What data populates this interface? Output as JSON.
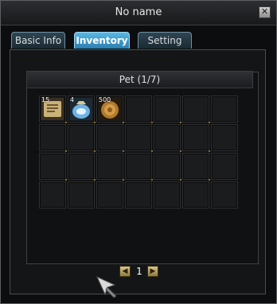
{
  "window": {
    "title": "No name",
    "close_label": "✕"
  },
  "tabs": [
    {
      "label": "Basic Info",
      "active": false
    },
    {
      "label": "Inventory",
      "active": true
    },
    {
      "label": "Setting",
      "active": false
    }
  ],
  "inventory": {
    "header": "Pet (1/7)",
    "columns": 7,
    "rows": 4,
    "items": [
      {
        "slot": 0,
        "count": "15",
        "icon": "scroll-icon",
        "color": "#c9b27a"
      },
      {
        "slot": 1,
        "count": "4",
        "icon": "blue-bag-icon",
        "color": "#6fb3e6"
      },
      {
        "slot": 2,
        "count": "500",
        "icon": "bronze-coin-icon",
        "color": "#b07a2c"
      }
    ]
  },
  "pager": {
    "prev_label": "◀",
    "page": "1",
    "next_label": "▶"
  },
  "colors": {
    "tab_active": "#3a9cd1",
    "tab_inactive": "#24363f",
    "slot": "#1b1c1d"
  }
}
